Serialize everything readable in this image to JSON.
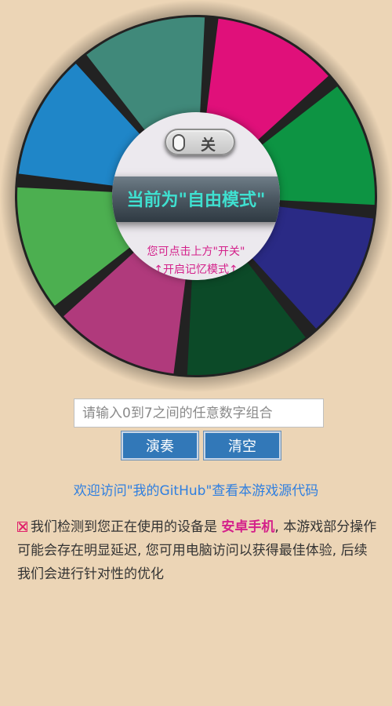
{
  "wheel": {
    "segments": [
      {
        "color": "#e0107a"
      },
      {
        "color": "#0d9443"
      },
      {
        "color": "#2a2a85"
      },
      {
        "color": "#0c4a28"
      },
      {
        "color": "#b03a7c"
      },
      {
        "color": "#4caf50"
      },
      {
        "color": "#1f86c8"
      },
      {
        "color": "#40897a"
      }
    ],
    "divider_color": "#222222"
  },
  "toggle": {
    "state_label": "关",
    "on": false
  },
  "mode": {
    "title": "当前为\"自由模式\"",
    "hint_line1": "您可点击上方\"开关\"",
    "hint_line2": "↑开启记忆模式↑"
  },
  "input": {
    "placeholder": "请输入0到7之间的任意数字组合",
    "value": ""
  },
  "buttons": {
    "play_label": "演奏",
    "clear_label": "清空"
  },
  "github_link": "欢迎访问\"我的GitHub\"查看本游戏源代码",
  "notice": {
    "before": "我们检测到您正在使用的设备是 ",
    "device": "安卓手机",
    "after": ", 本游戏部分操作可能会存在明显延迟, 您可用电脑访问以获得最佳体验, 后续我们会进行针对性的优化"
  }
}
